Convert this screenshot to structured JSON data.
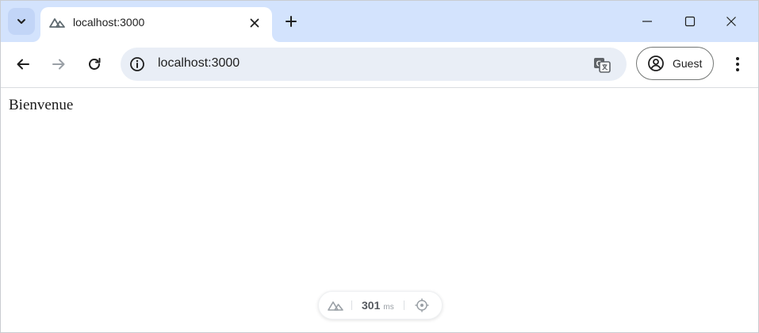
{
  "browser": {
    "tab": {
      "title": "localhost:3000",
      "favicon": "nuxt-logo-icon"
    },
    "address_bar": {
      "url": "localhost:3000"
    },
    "profile": {
      "label": "Guest"
    },
    "icons": {
      "tab_search": "chevron-down-icon",
      "tab_close": "close-icon",
      "new_tab": "plus-icon",
      "minimize": "minimize-icon",
      "maximize": "maximize-icon",
      "close_window": "close-icon",
      "back": "arrow-left-icon",
      "forward": "arrow-right-icon",
      "reload": "reload-icon",
      "site_info": "info-icon",
      "translate": "translate-icon",
      "profile": "account-circle-icon",
      "menu": "kebab-menu-icon"
    },
    "colors": {
      "tabstrip_bg": "#d3e3fd",
      "omnibox_bg": "#e9eef6",
      "forward_disabled": "#9aa0a6"
    }
  },
  "page": {
    "heading": "Bienvenue"
  },
  "dev_toolbar": {
    "time_value": "301",
    "time_unit": "ms",
    "logo": "nuxt-logo-icon",
    "inspect_icon": "target-icon"
  }
}
